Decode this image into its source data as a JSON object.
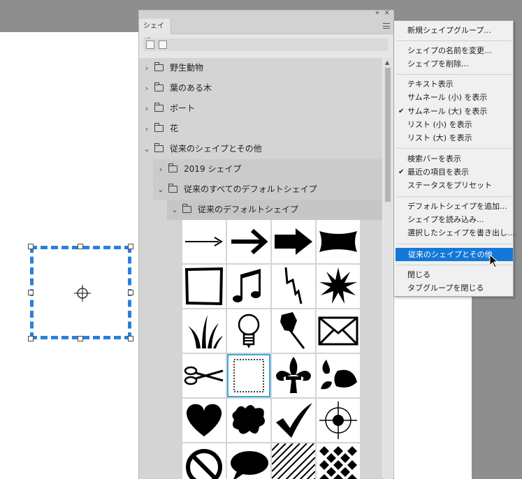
{
  "panel": {
    "tab_label": "シェイプ",
    "collapse_glyph": "«",
    "close_glyph": "×"
  },
  "tree": [
    {
      "label": "野生動物",
      "chevron": "›"
    },
    {
      "label": "葉のある木",
      "chevron": "›"
    },
    {
      "label": "ボート",
      "chevron": "›"
    },
    {
      "label": "花",
      "chevron": "›"
    },
    {
      "label": "従来のシェイプとその他",
      "chevron": "⌄"
    },
    {
      "label": "2019 シェイプ",
      "chevron": "›"
    },
    {
      "label": "従来のすべてのデフォルトシェイプ",
      "chevron": "⌄"
    },
    {
      "label": "従来のデフォルトシェイプ",
      "chevron": "⌄"
    }
  ],
  "shapes": [
    "arrow-thin",
    "arrow-bold",
    "arrow-heavy",
    "banner",
    "frame-rough",
    "music-notes",
    "lightning",
    "starburst",
    "grass",
    "lightbulb",
    "pushpin",
    "envelope",
    "scissors",
    "stamp-frame",
    "fleur-de-lis",
    "ornament-leaf",
    "heart",
    "blob",
    "checkmark",
    "target",
    "no-sign",
    "speech-bubble",
    "hatch-lines",
    "diamond-checker"
  ],
  "menu": {
    "items": [
      "新規シェイプグループ...",
      "シェイプの名前を変更...",
      "シェイプを削除...",
      "テキスト表示",
      "サムネール (小) を表示",
      "サムネール (大) を表示",
      "リスト (小) を表示",
      "リスト (大) を表示",
      "検索バーを表示",
      "最近の項目を表示",
      "ステータスをプリセット",
      "デフォルトシェイプを追加...",
      "シェイプを読み込み...",
      "選択したシェイプを書き出し...",
      "従来のシェイプとその他",
      "閉じる",
      "タブグループを閉じる"
    ],
    "check_glyph": "✔"
  },
  "colors": {
    "selection": "#2b7fe0",
    "menu_highlight": "#1478d8",
    "selected_cell": "#39a9e0"
  }
}
